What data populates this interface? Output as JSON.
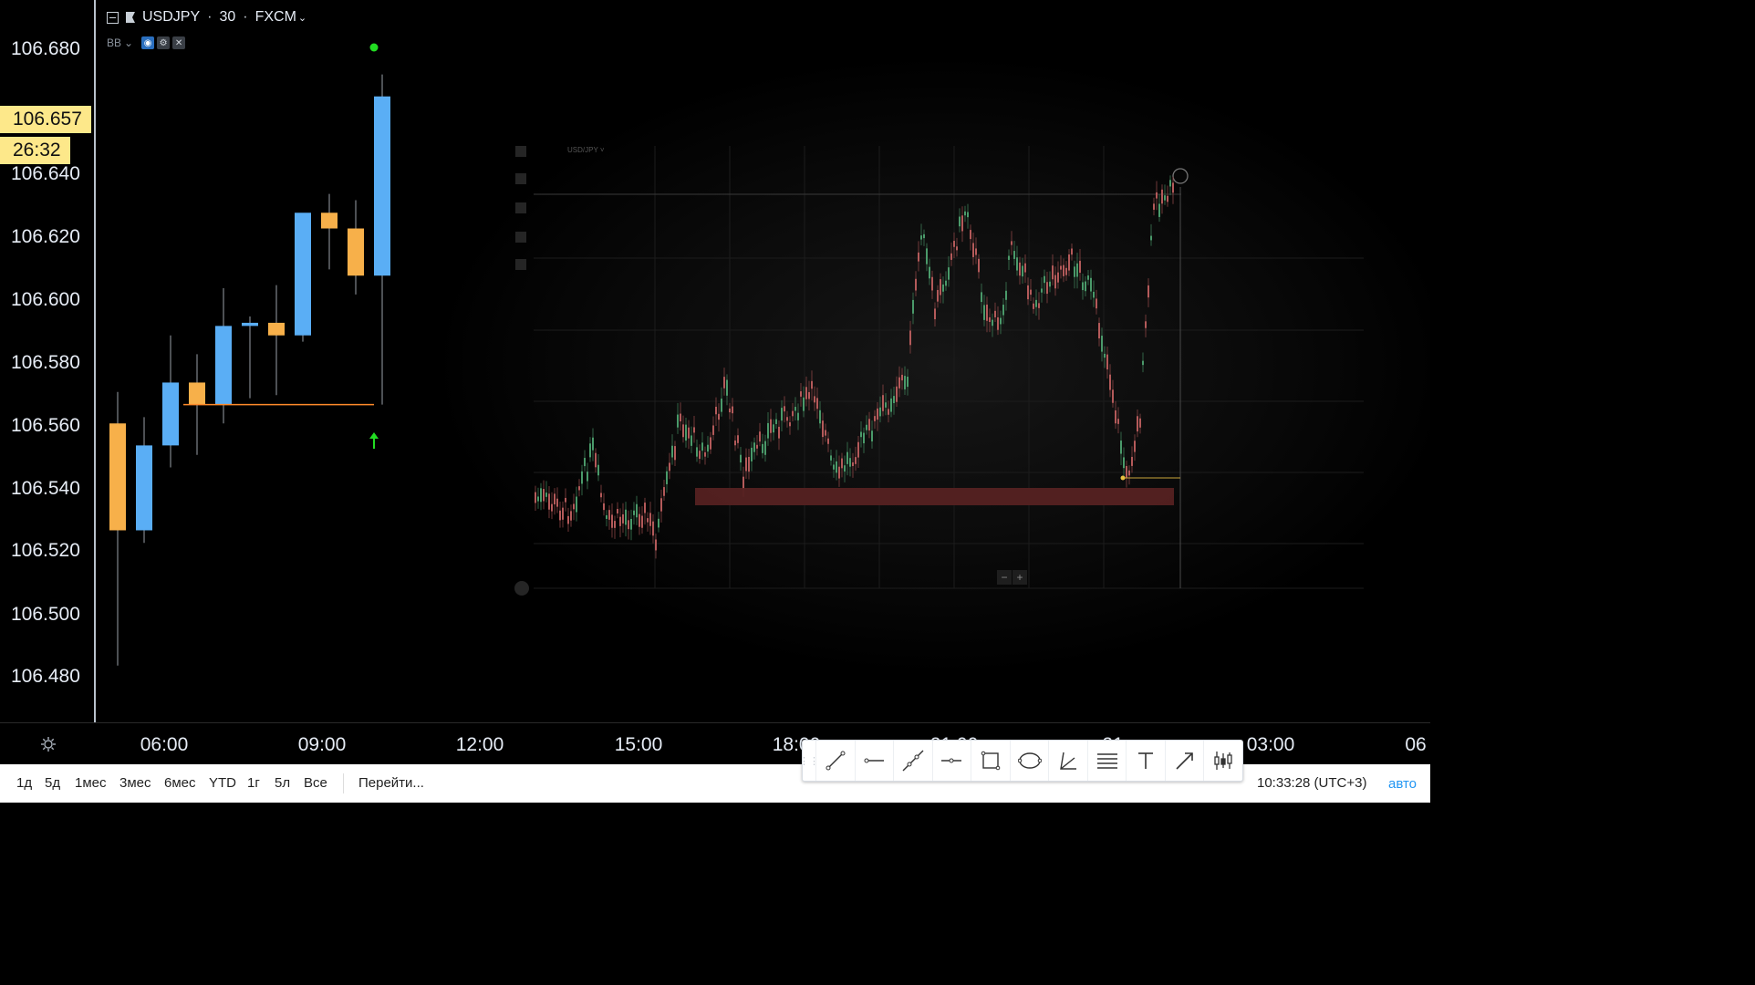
{
  "chart": {
    "symbol": "USDJPY",
    "interval": "30",
    "exchange": "FXCM",
    "indicator": "BB",
    "current_price": "106.657",
    "countdown": "26:32",
    "price_labels": [
      "106.680",
      "106.640",
      "106.620",
      "106.600",
      "106.580",
      "106.560",
      "106.540",
      "106.520",
      "106.500",
      "106.480"
    ],
    "time_labels": [
      "06:00",
      "09:00",
      "12:00",
      "15:00",
      "18:00",
      "21:00",
      "21",
      "03:00",
      "06"
    ],
    "colors": {
      "up": "#5aaef5",
      "down": "#f7b04a",
      "signal": "#22dd22",
      "level_line": "#ff8a2a"
    }
  },
  "chart_data": {
    "type": "candlestick",
    "candles": [
      {
        "open": 106.561,
        "high": 106.571,
        "low": 106.484,
        "close": 106.527
      },
      {
        "open": 106.527,
        "high": 106.563,
        "low": 106.523,
        "close": 106.554
      },
      {
        "open": 106.554,
        "high": 106.589,
        "low": 106.547,
        "close": 106.574
      },
      {
        "open": 106.574,
        "high": 106.583,
        "low": 106.551,
        "close": 106.567
      },
      {
        "open": 106.567,
        "high": 106.604,
        "low": 106.561,
        "close": 106.592
      },
      {
        "open": 106.592,
        "high": 106.595,
        "low": 106.569,
        "close": 106.593
      },
      {
        "open": 106.593,
        "high": 106.605,
        "low": 106.57,
        "close": 106.589
      },
      {
        "open": 106.589,
        "high": 106.625,
        "low": 106.587,
        "close": 106.628
      },
      {
        "open": 106.628,
        "high": 106.634,
        "low": 106.61,
        "close": 106.623
      },
      {
        "open": 106.623,
        "high": 106.632,
        "low": 106.602,
        "close": 106.608
      },
      {
        "open": 106.608,
        "high": 106.672,
        "low": 106.567,
        "close": 106.665
      }
    ],
    "horizontal_level": 106.567
  },
  "bottom_bar": {
    "periods": [
      "1д",
      "5д",
      "1мес",
      "3мес",
      "6мес",
      "YTD",
      "1г",
      "5л",
      "Все"
    ],
    "goto": "Перейти...",
    "clock": "10:33:28 (UTC+3)",
    "auto": "авто"
  },
  "toolbar": {
    "tools": [
      "trend-line-icon",
      "horizontal-ray-icon",
      "extended-line-icon",
      "horizontal-line-icon",
      "rectangle-icon",
      "ellipse-icon",
      "angle-icon",
      "parallel-lines-icon",
      "text-icon",
      "arrow-icon",
      "candlestick-icon"
    ]
  }
}
